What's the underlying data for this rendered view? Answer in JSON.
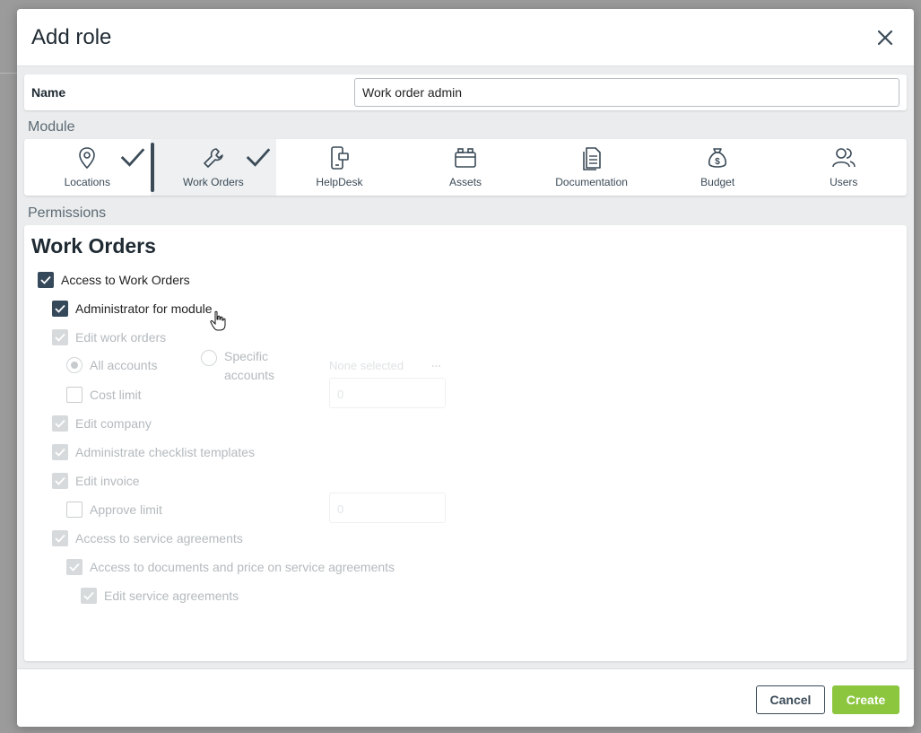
{
  "dialog": {
    "title": "Add role",
    "close_icon": "close-icon"
  },
  "name_field": {
    "label": "Name",
    "value": "Work order admin"
  },
  "module_section": {
    "label": "Module",
    "items": [
      {
        "label": "Locations",
        "icon": "location-pin-icon",
        "checked": true,
        "active": false
      },
      {
        "label": "Work Orders",
        "icon": "wrench-icon",
        "checked": true,
        "active": true
      },
      {
        "label": "HelpDesk",
        "icon": "phone-chat-icon",
        "checked": false,
        "active": false
      },
      {
        "label": "Assets",
        "icon": "boxes-icon",
        "checked": false,
        "active": false
      },
      {
        "label": "Documentation",
        "icon": "document-icon",
        "checked": false,
        "active": false
      },
      {
        "label": "Budget",
        "icon": "money-bag-icon",
        "checked": false,
        "active": false
      },
      {
        "label": "Users",
        "icon": "users-icon",
        "checked": false,
        "active": false
      }
    ]
  },
  "permissions": {
    "label": "Permissions",
    "title": "Work Orders",
    "access": "Access to Work Orders",
    "admin": "Administrator for module",
    "edit_work_orders": "Edit work orders",
    "all_accounts": "All accounts",
    "specific_accounts_line1": "Specific",
    "specific_accounts_line2": "accounts",
    "none_selected": "None selected",
    "ellipsis": "...",
    "cost_limit": "Cost limit",
    "cost_limit_value": "0",
    "edit_company": "Edit company",
    "admin_checklist": "Administrate checklist templates",
    "edit_invoice": "Edit invoice",
    "approve_limit": "Approve limit",
    "approve_limit_value": "0",
    "access_service": "Access to service agreements",
    "access_docs_price": "Access to documents and price on service agreements",
    "edit_service": "Edit service agreements"
  },
  "footer": {
    "cancel": "Cancel",
    "create": "Create"
  },
  "colors": {
    "primary_dark": "#36495a",
    "create_green": "#8cc63f",
    "disabled": "#d7dadc"
  }
}
